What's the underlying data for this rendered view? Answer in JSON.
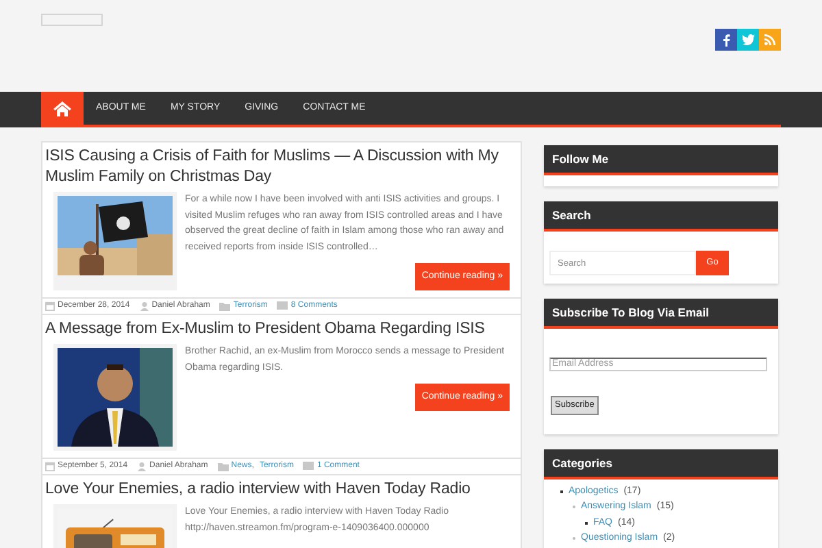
{
  "nav": {
    "items": [
      {
        "label": "ABOUT ME",
        "selected": false
      },
      {
        "label": "MY STORY",
        "selected": false
      },
      {
        "label": "GIVING",
        "selected": false
      },
      {
        "label": "CONTACT ME",
        "selected": false
      }
    ],
    "home_selected": true
  },
  "posts": [
    {
      "title": "ISIS Causing a Crisis of Faith for Muslims — A Discussion with My Muslim Family on Christmas Day",
      "picture": {
        "kind": "picture"
      },
      "excerpt": "For a while now I have been involved with anti ISIS activities and groups. I visited Muslim refuges who ran away from ISIS controlled areas and I have observed the great decline of faith in Islam among those who ran away and received reports from inside ISIS controlled…",
      "button": "Continue reading »",
      "date": "December 28, 2014",
      "author": "Daniel Abraham",
      "categories": [
        "Terrorism"
      ],
      "comments": "8 Comments"
    },
    {
      "title": "A Message from Ex-Muslim to President Obama Regarding ISIS",
      "picture": {
        "kind": "picture"
      },
      "excerpt": "Brother Rachid, an ex-Muslim from Morocco sends a message to President Obama regarding ISIS.",
      "button": "Continue reading »",
      "date": "September 5, 2014",
      "author": "Daniel Abraham",
      "categories": [
        "News",
        "Terrorism"
      ],
      "category_separator": ",",
      "comments": "1 Comment"
    },
    {
      "title": "Love Your Enemies, a radio interview with Haven Today Radio",
      "picture": {
        "kind": "picture"
      },
      "excerpt": "Love Your Enemies, a radio interview with Haven Today Radio http://haven.streamon.fm/program-e-1409036400.000000"
    }
  ],
  "sidebar": {
    "follow": {
      "title": "Follow Me"
    },
    "search": {
      "title": "Search",
      "placeholder": "Search",
      "button": "Go"
    },
    "subscribe": {
      "title": "Subscribe To Blog Via Email",
      "placeholder": "Email Address",
      "button": "Subscribe"
    },
    "categories": {
      "title": "Categories",
      "items": [
        {
          "name": "Apologetics",
          "count": "(17)",
          "children": [
            {
              "name": "Answering Islam",
              "count": "(15)",
              "children": [
                {
                  "name": "FAQ",
                  "count": "(14)"
                }
              ]
            },
            {
              "name": "Questioning Islam",
              "count": "(2)"
            }
          ]
        }
      ]
    }
  }
}
